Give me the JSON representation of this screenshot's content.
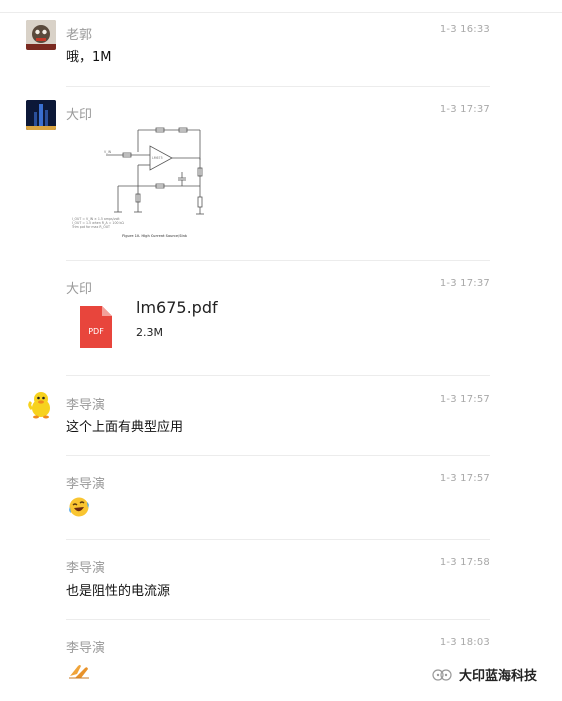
{
  "messages": [
    {
      "sender": "老郭",
      "time": "1-3 16:33",
      "text": "哦，1M"
    },
    {
      "sender": "大印",
      "time": "1-3 17:37",
      "image_caption": "Figure 10. High Current Source/Sink",
      "image_notes": [
        "I_OUT = V_IN × 1.5 amps/volt",
        "I_OUT = 1.5 when R_A = 100 kΩ",
        "Trim pot for max R_OUT"
      ]
    },
    {
      "sender": "大印",
      "time": "1-3 17:37",
      "file_name": "lm675.pdf",
      "file_size": "2.3M",
      "file_type": "PDF"
    },
    {
      "sender": "李导演",
      "time": "1-3 17:57",
      "text": "这个上面有典型应用"
    },
    {
      "sender": "李导演",
      "time": "1-3 17:57",
      "emoji": "laughing-crying-emoji"
    },
    {
      "sender": "李导演",
      "time": "1-3 17:58",
      "text": "也是阻性的电流源"
    },
    {
      "sender": "李导演",
      "time": "1-3 18:03",
      "emoji": "clapping-hands-emoji"
    }
  ],
  "watermark": {
    "text": "大印蓝海科技"
  },
  "colors": {
    "pdf_red": "#e8453c",
    "separator": "#ececec",
    "muted": "#9a9a9a"
  }
}
